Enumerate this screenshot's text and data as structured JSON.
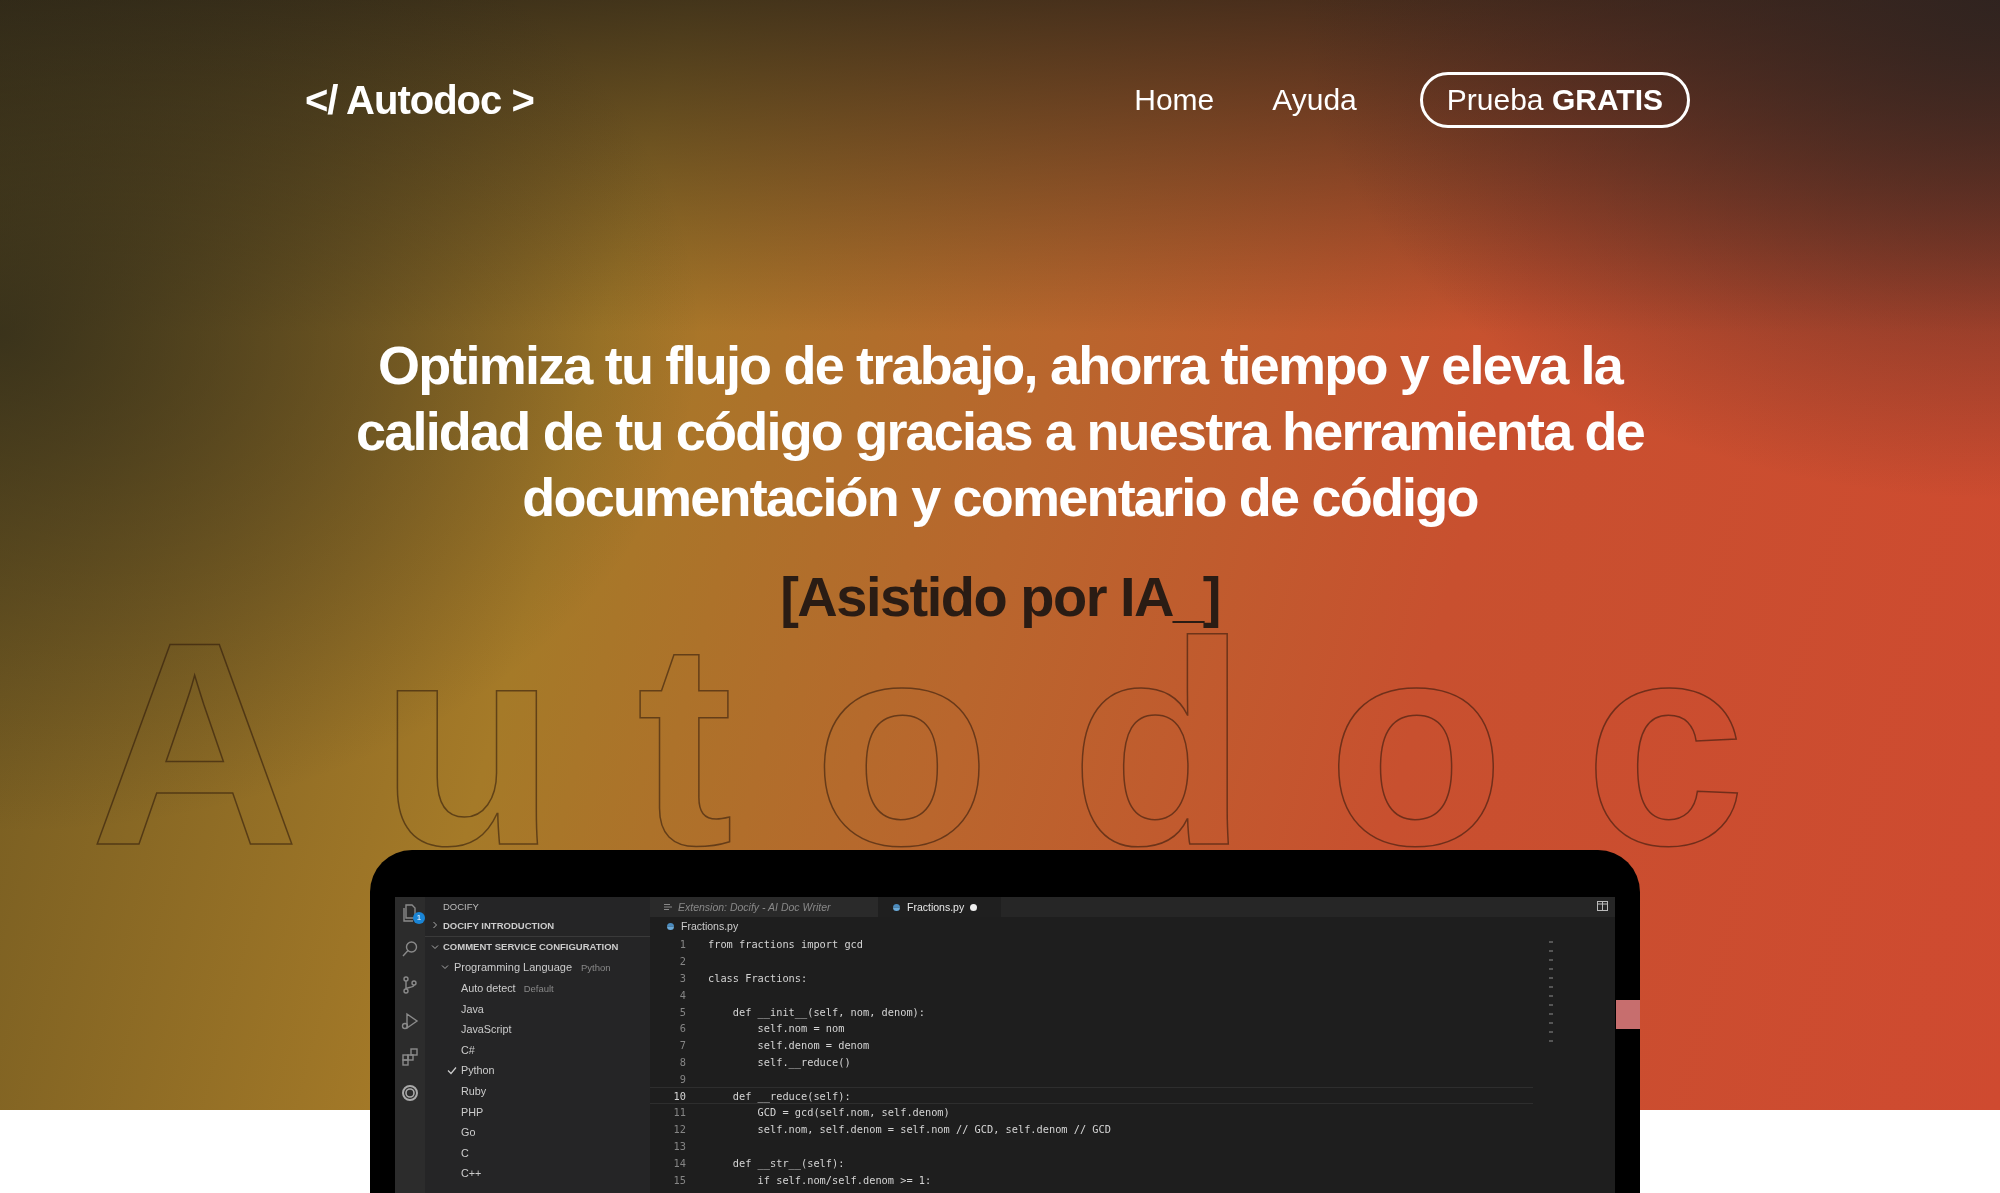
{
  "nav": {
    "logo": "</ Autodoc >",
    "links": [
      {
        "label": "Home"
      },
      {
        "label": "Ayuda"
      }
    ],
    "cta": "Prueba **GRATIS**"
  },
  "hero": {
    "background_word": "Autodoc",
    "headline": "Optimiza tu flujo de trabajo, ahorra tiempo y eleva la calidad de tu código gracias a nuestra herramienta de documentación y comentario de código",
    "tagline": "[Asistido por IA_]"
  },
  "editor": {
    "activity_bar": [
      {
        "kind": "files",
        "badge": "1"
      },
      {
        "kind": "search"
      },
      {
        "kind": "branch"
      },
      {
        "kind": "run"
      },
      {
        "kind": "extensions"
      },
      {
        "kind": "ring"
      }
    ],
    "explorer": {
      "title": "DOCIFY",
      "sections": [
        {
          "label": "DOCIFY INTRODUCTION",
          "expanded": false
        },
        {
          "label": "COMMENT SERVICE CONFIGURATION",
          "expanded": true,
          "children": [
            {
              "label": "Programming Language",
              "description": "Python",
              "expanded": true,
              "children": [
                {
                  "label": "Auto detect",
                  "description": "Default",
                  "checked": false
                },
                {
                  "label": "Java",
                  "checked": false
                },
                {
                  "label": "JavaScript",
                  "checked": false
                },
                {
                  "label": "C#",
                  "checked": false
                },
                {
                  "label": "Python",
                  "checked": true
                },
                {
                  "label": "Ruby",
                  "checked": false
                },
                {
                  "label": "PHP",
                  "checked": false
                },
                {
                  "label": "Go",
                  "checked": false
                },
                {
                  "label": "C",
                  "checked": false
                },
                {
                  "label": "C++",
                  "checked": false
                }
              ]
            }
          ]
        }
      ]
    },
    "tabs": [
      {
        "label": "Extension: Docify - AI Doc Writer",
        "kind": "preview",
        "selected": false,
        "modified": false
      },
      {
        "label": "Fractions.py",
        "kind": "python",
        "selected": true,
        "modified": true
      }
    ],
    "breadcrumb": "Fractions.py",
    "lines": [
      {
        "number": "1",
        "current": false,
        "text": "from fractions import gcd"
      },
      {
        "number": "2",
        "current": false
      },
      {
        "number": "3",
        "current": false,
        "text": "class Fractions:"
      },
      {
        "number": "4",
        "current": false
      },
      {
        "number": "5",
        "current": false,
        "text": "    def __init__(self, nom, denom):"
      },
      {
        "number": "6",
        "current": false,
        "text": "        self.nom = nom"
      },
      {
        "number": "7",
        "current": false,
        "text": "        self.denom = denom"
      },
      {
        "number": "8",
        "current": false,
        "text": "        self.__reduce()"
      },
      {
        "number": "9",
        "current": false
      },
      {
        "number": "10",
        "current": true,
        "text": "    def __reduce(self):"
      },
      {
        "number": "11",
        "current": false,
        "text": "        GCD = gcd(self.nom, self.denom)"
      },
      {
        "number": "12",
        "current": false,
        "text": "        self.nom, self.denom = self.nom // GCD, self.denom // GCD"
      },
      {
        "number": "13",
        "current": false
      },
      {
        "number": "14",
        "current": false,
        "text": "    def __str__(self):"
      },
      {
        "number": "15",
        "current": false,
        "text": "        if self.nom/self.denom >= 1:"
      }
    ]
  }
}
